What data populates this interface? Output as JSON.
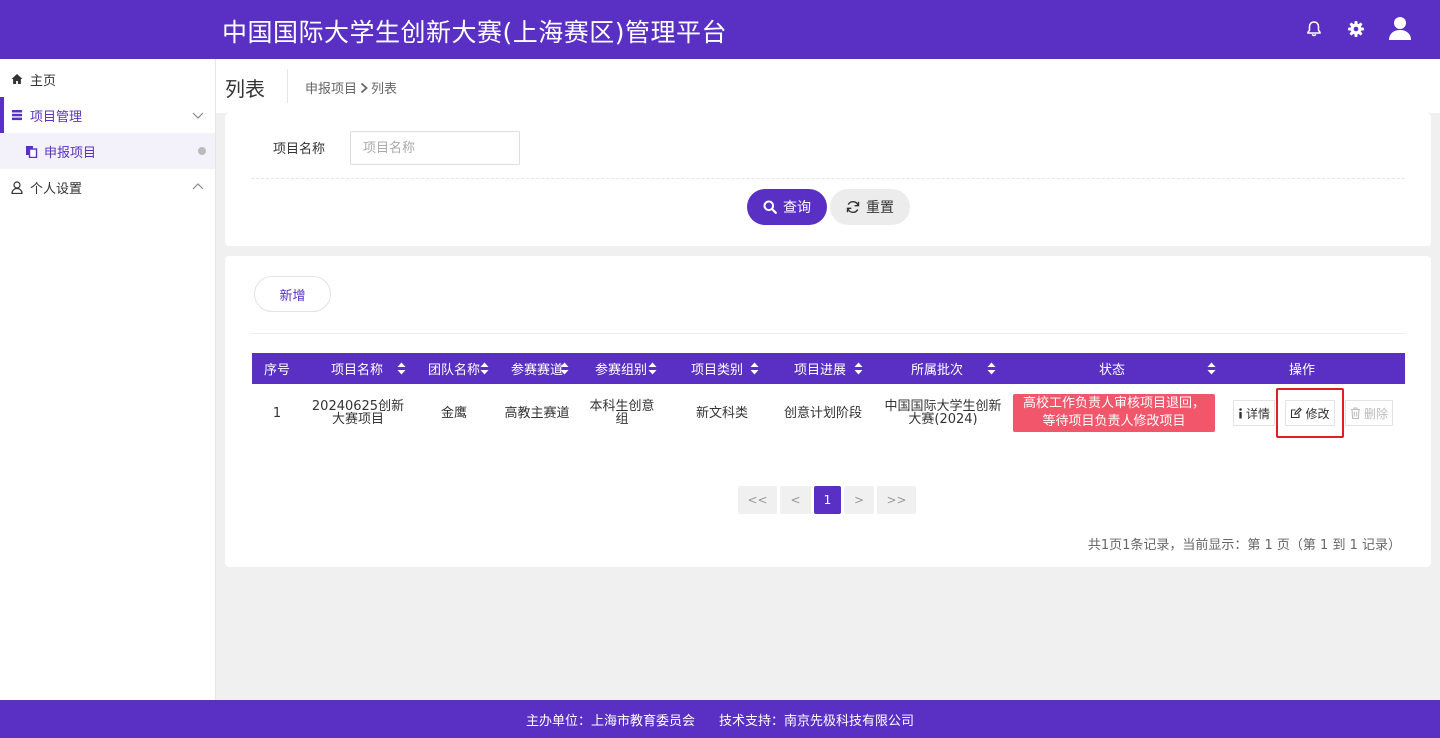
{
  "header": {
    "title": "中国国际大学生创新大赛(上海赛区)管理平台",
    "icons": [
      "bell-icon",
      "gear-icon",
      "user-avatar-icon"
    ]
  },
  "sidebar": {
    "items": [
      {
        "label": "主页",
        "icon": "home-icon"
      },
      {
        "label": "项目管理",
        "icon": "list-icon",
        "expanded": true
      },
      {
        "label": "申报项目",
        "icon": "copy-icon",
        "active": true
      },
      {
        "label": "个人设置",
        "icon": "user-icon"
      }
    ]
  },
  "page": {
    "title": "列表",
    "breadcrumb": [
      "申报项目",
      "列表"
    ]
  },
  "search": {
    "label": "项目名称",
    "placeholder": "项目名称",
    "value": "",
    "query_label": "查询",
    "reset_label": "重置"
  },
  "list": {
    "add_label": "新增",
    "columns": [
      "序号",
      "项目名称",
      "团队名称",
      "参赛赛道",
      "参赛组别",
      "项目类别",
      "项目进展",
      "所属批次",
      "状态",
      "操作"
    ],
    "rows": [
      {
        "index": "1",
        "project_name": "20240625创新大赛项目",
        "team_name": "金鹰",
        "track": "高教主赛道",
        "group": "本科生创意组",
        "category": "新文科类",
        "progress": "创意计划阶段",
        "batch": "中国国际大学生创新大赛(2024)",
        "status": "高校工作负责人审核项目退回，等待项目负责人修改项目",
        "actions": {
          "detail": "详情",
          "edit": "修改",
          "delete": "删除"
        }
      }
    ]
  },
  "pagination": {
    "first": "<<",
    "prev": "<",
    "current": "1",
    "next": ">",
    "last": ">>",
    "summary": "共1页1条记录，当前显示：第 1 页（第 1 到 1 记录）"
  },
  "footer": {
    "host": "主办单位：上海市教育委员会",
    "support": "技术支持：南京先极科技有限公司"
  },
  "colors": {
    "primary": "#5a30c4",
    "status_badge": "#f2566b",
    "highlight": "#e02020"
  }
}
